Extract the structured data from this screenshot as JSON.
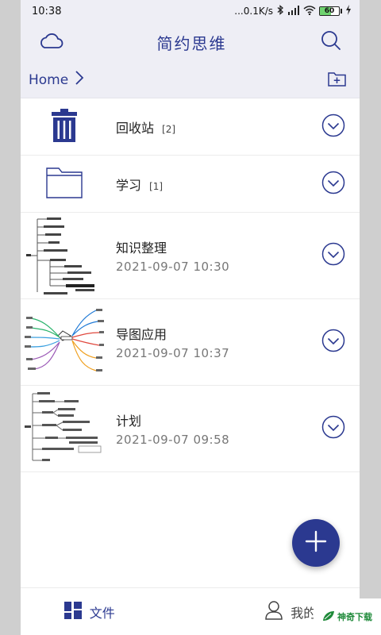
{
  "status": {
    "time": "10:38",
    "network_speed": "...0.1K/s",
    "battery_level": "60",
    "battery_fraction": 0.6
  },
  "appbar": {
    "title": "简约思维",
    "left_icon": "cloud-icon",
    "right_icon": "search-icon"
  },
  "breadcrumb": {
    "home": "Home"
  },
  "items": [
    {
      "type": "trash",
      "name": "回收站",
      "count": "[2]"
    },
    {
      "type": "folder",
      "name": "学习",
      "count": "[1]"
    },
    {
      "type": "mindmap",
      "name": "知识整理",
      "date": "2021-09-07 10:30"
    },
    {
      "type": "mindmap",
      "name": "导图应用",
      "date": "2021-09-07 10:37"
    },
    {
      "type": "mindmap",
      "name": "计划",
      "date": "2021-09-07 09:58"
    }
  ],
  "nav": {
    "files": "文件",
    "me": "我的"
  },
  "colors": {
    "accent": "#2b3990",
    "bar_bg": "#eeeef5"
  }
}
